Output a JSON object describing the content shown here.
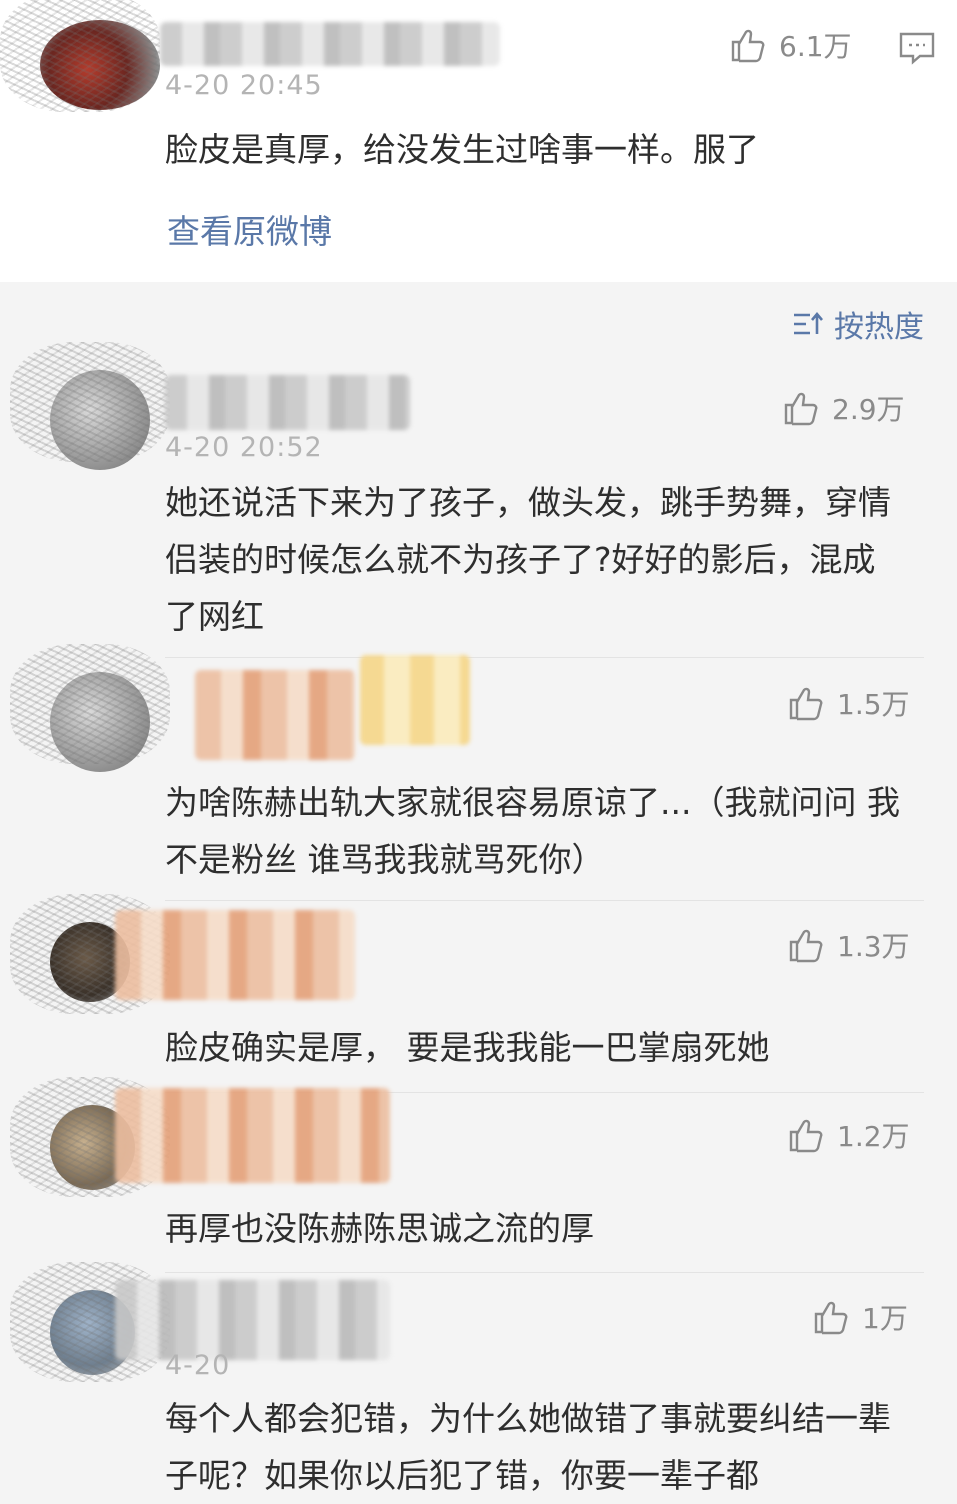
{
  "top": {
    "time": "4-20 20:45",
    "likes": "6.1万",
    "text": "脸皮是真厚，给没发生过啥事一样。服了",
    "view_original": "查看原微博"
  },
  "sort": {
    "label": "按热度",
    "icon": "sort-icon"
  },
  "comments": [
    {
      "time": "4-20 20:52",
      "likes": "2.9万",
      "text": "她还说活下来为了孩子，做头发，跳手势舞，穿情侣装的时候怎么就不为孩子了?好好的影后，混成了网红"
    },
    {
      "time": "",
      "likes": "1.5万",
      "text": "为啥陈赫出轨大家就很容易原谅了...（我就问问 我不是粉丝 谁骂我我就骂死你）"
    },
    {
      "time": "",
      "likes": "1.3万",
      "text": "脸皮确实是厚， 要是我我能一巴掌扇死她"
    },
    {
      "time": "",
      "likes": "1.2万",
      "text": "再厚也没陈赫陈思诚之流的厚"
    },
    {
      "time": "4-20",
      "likes": "1万",
      "text": "每个人都会犯错，为什么她做错了事就要纠结一辈子呢？如果你以后犯了错，你要一辈子都"
    }
  ],
  "colors": {
    "link": "#5a78a8",
    "like": "#8a8a8a",
    "bg": "#f4f4f4"
  }
}
